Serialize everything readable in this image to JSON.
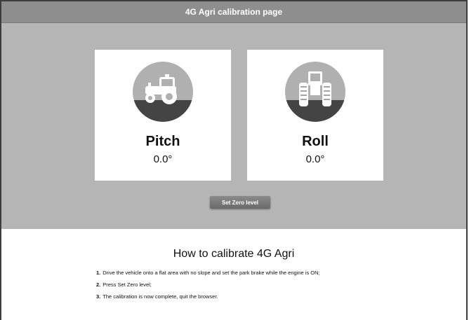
{
  "header": {
    "title": "4G Agri calibration page"
  },
  "cards": {
    "pitch": {
      "label": "Pitch",
      "value": "0.0°",
      "icon": "tractor-side-icon"
    },
    "roll": {
      "label": "Roll",
      "value": "0.0°",
      "icon": "tractor-rear-icon"
    }
  },
  "actions": {
    "set_zero_label": "Set Zero level"
  },
  "instructions": {
    "title": "How to calibrate 4G Agri",
    "steps": [
      {
        "num": "1.",
        "text": "Drive the vehicle onto a flat area with no slope and set the park brake while the engine is ON;"
      },
      {
        "num": "2.",
        "text": "Press Set Zero level;"
      },
      {
        "num": "3.",
        "text": "The calibration is now complete, quit the browser."
      }
    ]
  },
  "colors": {
    "titlebar": "#8e8e8e",
    "panel": "#b5b5b5",
    "sky": "#b0b0b0",
    "ground": "#444444",
    "button": "#777777"
  }
}
